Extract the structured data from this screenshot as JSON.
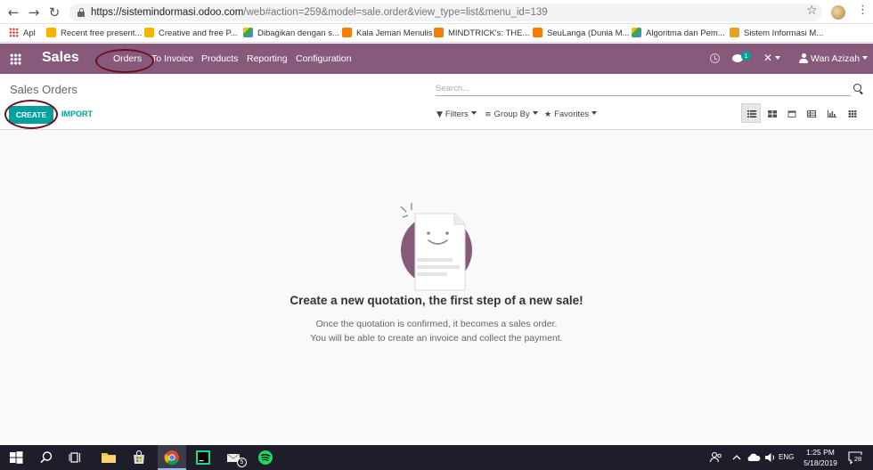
{
  "browser": {
    "url_host": "https://sistemindormasi.odoo.com",
    "url_path": "/web#action=259&model=sale.order&view_type=list&menu_id=139",
    "bookmarks": [
      {
        "label": "Apl",
        "icon": "apps-grid-icon"
      },
      {
        "label": "Recent free present...",
        "icon": "slides-icon",
        "color": "#f6b400"
      },
      {
        "label": "Creative and free P...",
        "icon": "slides-icon",
        "color": "#f6b400"
      },
      {
        "label": "Dibagikan dengan s...",
        "icon": "drive-icon",
        "color": "#34a853"
      },
      {
        "label": "Kala Jemari Menulis",
        "icon": "blogger-icon",
        "color": "#f57d00"
      },
      {
        "label": "MINDTRICK's: THE...",
        "icon": "blogger-icon",
        "color": "#f57d00"
      },
      {
        "label": "SeuLanga (Dunia M...",
        "icon": "blogger-icon",
        "color": "#f57d00"
      },
      {
        "label": "Algoritma dan Pem...",
        "icon": "drive-icon",
        "color": "#34a853"
      },
      {
        "label": "Sistem Informasi M...",
        "icon": "site-icon",
        "color": "#e8a020"
      }
    ]
  },
  "navbar": {
    "app_title": "Sales",
    "menu": [
      "Orders",
      "To Invoice",
      "Products",
      "Reporting",
      "Configuration"
    ],
    "chat_badge": "1",
    "user_name": "Wan Azizah"
  },
  "control_panel": {
    "title": "Sales Orders",
    "search_placeholder": "Search...",
    "create_label": "CREATE",
    "import_label": "IMPORT",
    "filters_label": "Filters",
    "group_by_label": "Group By",
    "favorites_label": "Favorites"
  },
  "empty_state": {
    "title": "Create a new quotation, the first step of a new sale!",
    "line1": "Once the quotation is confirmed, it becomes a sales order.",
    "line2": "You will be able to create an invoice and collect the payment."
  },
  "taskbar": {
    "time": "1:25 PM",
    "date": "5/18/2019",
    "lang": "ENG",
    "mail_badge": "5",
    "notif_badge": "28"
  },
  "colors": {
    "brand": "#875a7b",
    "accent": "#00a09d",
    "annotation": "#6d0f21"
  }
}
